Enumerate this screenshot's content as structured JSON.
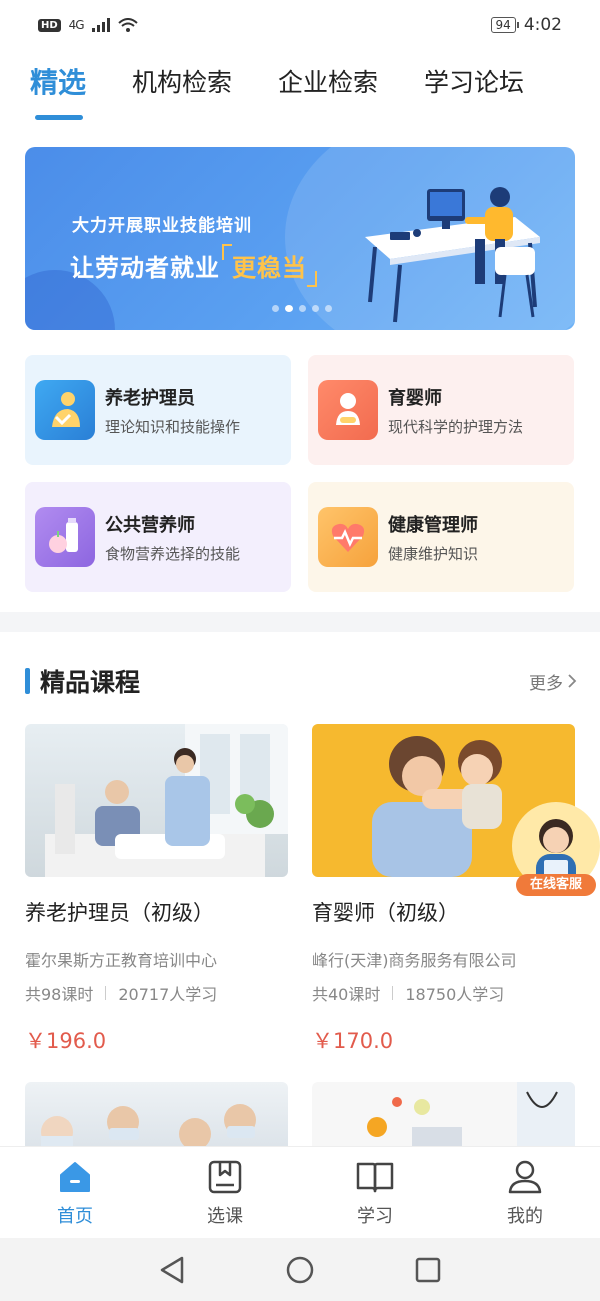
{
  "status_bar": {
    "hd": "HD",
    "network": "4G",
    "battery": "94",
    "time": "4:02"
  },
  "top_tabs": [
    {
      "label": "精选",
      "active": true
    },
    {
      "label": "机构检索",
      "active": false
    },
    {
      "label": "企业检索",
      "active": false
    },
    {
      "label": "学习论坛",
      "active": false
    }
  ],
  "banner": {
    "subtitle": "大力开展职业技能培训",
    "main_prefix": "让劳动者就业",
    "main_highlight": "更稳当",
    "dot_count": 5,
    "active_dot": 1
  },
  "categories": [
    {
      "title": "养老护理员",
      "desc": "理论知识和技能操作",
      "icon": "elder-care-icon"
    },
    {
      "title": "育婴师",
      "desc": "现代科学的护理方法",
      "icon": "baby-icon"
    },
    {
      "title": "公共营养师",
      "desc": "食物营养选择的技能",
      "icon": "nutrition-icon"
    },
    {
      "title": "健康管理师",
      "desc": "健康维护知识",
      "icon": "heart-pulse-icon"
    }
  ],
  "section": {
    "title": "精品课程",
    "more": "更多"
  },
  "courses": [
    {
      "title": "养老护理员（初级）",
      "org": "霍尔果斯方正教育培训中心",
      "hours": "共98课时",
      "learners": "20717人学习",
      "price": "￥196.0"
    },
    {
      "title": "育婴师（初级）",
      "org": "峰行(天津)商务服务有限公司",
      "hours": "共40课时",
      "learners": "18750人学习",
      "price": "￥170.0"
    }
  ],
  "service": {
    "label": "在线客服"
  },
  "bottom_nav": [
    {
      "label": "首页",
      "icon": "home-icon",
      "active": true
    },
    {
      "label": "选课",
      "icon": "book-select-icon",
      "active": false
    },
    {
      "label": "学习",
      "icon": "open-book-icon",
      "active": false
    },
    {
      "label": "我的",
      "icon": "user-icon",
      "active": false
    }
  ],
  "colors": {
    "accent": "#2f8ed8",
    "price": "#e25b4c",
    "banner_highlight": "#ffc34a",
    "service_badge": "#f07a3a"
  }
}
